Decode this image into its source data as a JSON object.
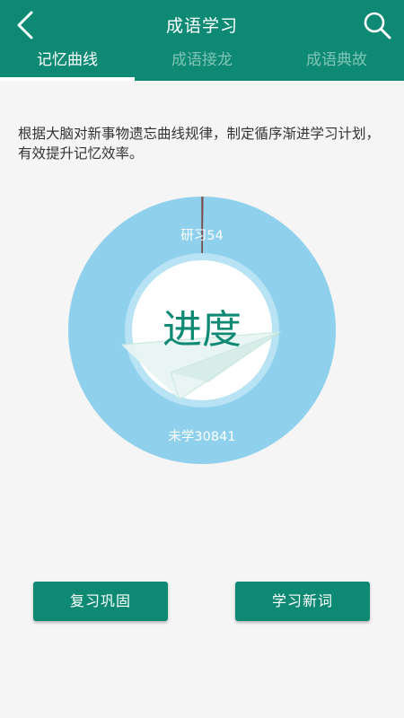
{
  "header": {
    "title": "成语学习",
    "back_icon": "chevron-left-icon",
    "search_icon": "search-icon"
  },
  "tabs": [
    {
      "label": "记忆曲线",
      "active": true
    },
    {
      "label": "成语接龙",
      "active": false
    },
    {
      "label": "成语典故",
      "active": false
    }
  ],
  "description": "根据大脑对新事物遗忘曲线规律，制定循序渐进学习计划，有效提升记忆效率。",
  "progress": {
    "center_label": "进度",
    "learned_label": "研习54",
    "unlearned_label": "未学30841"
  },
  "chart_data": {
    "type": "pie",
    "categories": [
      "研习",
      "未学"
    ],
    "values": [
      54,
      30841
    ],
    "colors": [
      "#7a4a4a",
      "#8fd0ec"
    ]
  },
  "buttons": {
    "review": "复习巩固",
    "learn": "学习新词"
  },
  "colors": {
    "primary": "#0e8a74",
    "ring": "#8fd0ec",
    "inner_ring": "#b8e3f5",
    "background": "#f5f5f5"
  }
}
